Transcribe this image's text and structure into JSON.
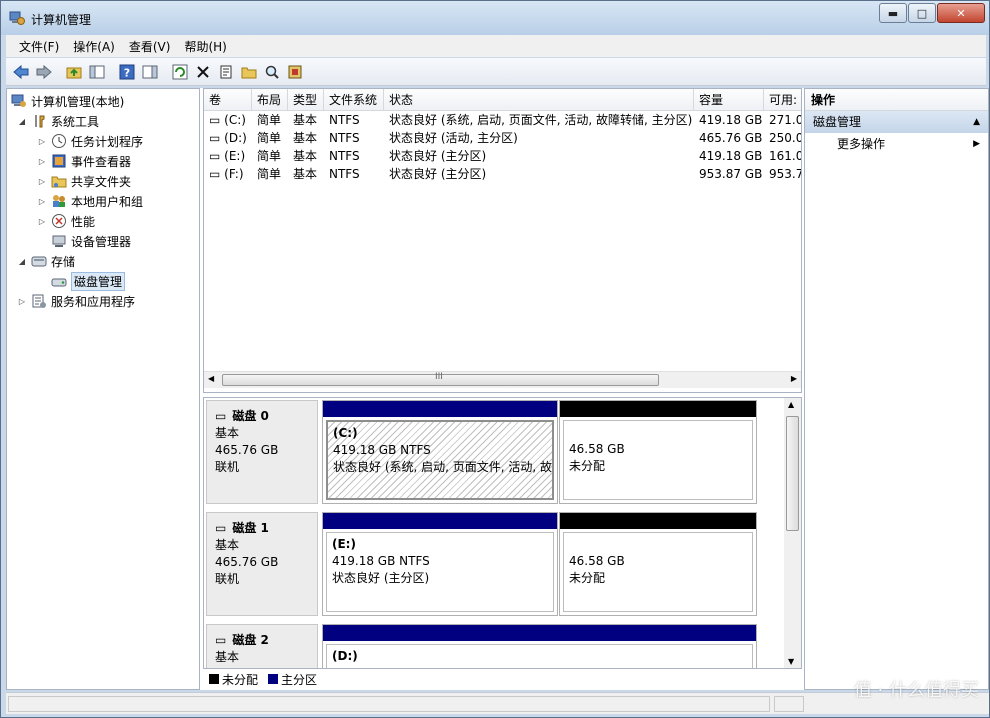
{
  "window": {
    "title": "计算机管理",
    "min": "▬",
    "max": "□",
    "close": "✕"
  },
  "menu": [
    "文件(F)",
    "操作(A)",
    "查看(V)",
    "帮助(H)"
  ],
  "tree": [
    {
      "label": "计算机管理(本地)",
      "level": 0,
      "expander": ""
    },
    {
      "label": "系统工具",
      "level": 1,
      "expander": "◢"
    },
    {
      "label": "任务计划程序",
      "level": 2,
      "expander": "▷"
    },
    {
      "label": "事件查看器",
      "level": 2,
      "expander": "▷"
    },
    {
      "label": "共享文件夹",
      "level": 2,
      "expander": "▷"
    },
    {
      "label": "本地用户和组",
      "level": 2,
      "expander": "▷"
    },
    {
      "label": "性能",
      "level": 2,
      "expander": "▷"
    },
    {
      "label": "设备管理器",
      "level": 2,
      "expander": ""
    },
    {
      "label": "存储",
      "level": 1,
      "expander": "◢"
    },
    {
      "label": "磁盘管理",
      "level": 2,
      "expander": ""
    },
    {
      "label": "服务和应用程序",
      "level": 1,
      "expander": "▷"
    }
  ],
  "volumes": {
    "headers": [
      "卷",
      "布局",
      "类型",
      "文件系统",
      "状态",
      "容量",
      "可用:"
    ],
    "rows": [
      [
        "(C:)",
        "简单",
        "基本",
        "NTFS",
        "状态良好 (系统, 启动, 页面文件, 活动, 故障转储, 主分区)",
        "419.18 GB",
        "271.0"
      ],
      [
        "(D:)",
        "简单",
        "基本",
        "NTFS",
        "状态良好 (活动, 主分区)",
        "465.76 GB",
        "250.0"
      ],
      [
        "(E:)",
        "简单",
        "基本",
        "NTFS",
        "状态良好 (主分区)",
        "419.18 GB",
        "161.0"
      ],
      [
        "(F:)",
        "简单",
        "基本",
        "NTFS",
        "状态良好 (主分区)",
        "953.87 GB",
        "953.7"
      ]
    ],
    "scroll_grip": "III"
  },
  "disks": [
    {
      "name": "磁盘 0",
      "type": "基本",
      "size": "465.76 GB",
      "status": "联机",
      "partitions": [
        {
          "label": "(C:)",
          "size": "419.18 GB NTFS",
          "status": "状态良好 (系统, 启动, 页面文件, 活动, 故障转储, 主分区)",
          "color": "#000080",
          "selected": true
        },
        {
          "label": "",
          "size": "46.58 GB",
          "status": "未分配",
          "color": "#000000",
          "selected": false
        }
      ]
    },
    {
      "name": "磁盘 1",
      "type": "基本",
      "size": "465.76 GB",
      "status": "联机",
      "partitions": [
        {
          "label": "(E:)",
          "size": "419.18 GB NTFS",
          "status": "状态良好 (主分区)",
          "color": "#000080",
          "selected": false
        },
        {
          "label": "",
          "size": "46.58 GB",
          "status": "未分配",
          "color": "#000000",
          "selected": false
        }
      ]
    },
    {
      "name": "磁盘 2",
      "type": "基本",
      "size": "",
      "status": "",
      "partitions": [
        {
          "label": "(D:)",
          "size": "",
          "status": "",
          "color": "#000080",
          "selected": false
        }
      ]
    }
  ],
  "legend": [
    {
      "label": "未分配",
      "color": "#000000"
    },
    {
      "label": "主分区",
      "color": "#000080"
    }
  ],
  "actions": {
    "header": "操作",
    "section": "磁盘管理",
    "more": "更多操作"
  },
  "watermark": "值 · 什么值得买"
}
